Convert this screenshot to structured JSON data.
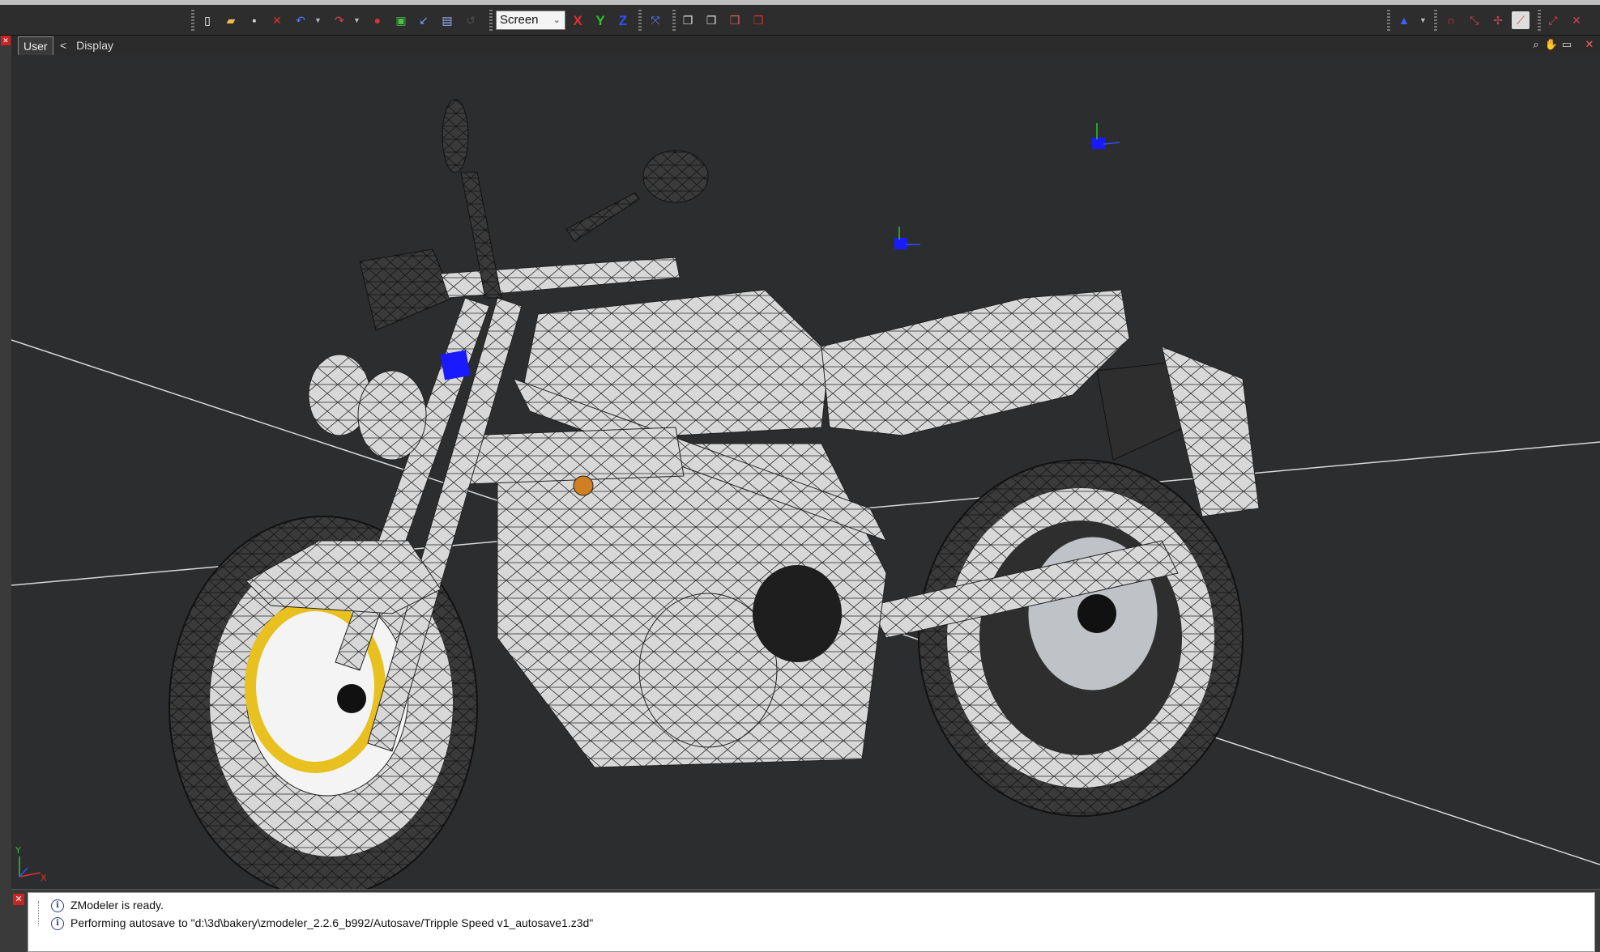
{
  "toolbar": {
    "coord_system": "Screen",
    "axis_x": "X",
    "axis_y": "Y",
    "axis_z": "Z"
  },
  "viewport": {
    "view_label": "User",
    "display_tab": "Display",
    "back_glyph": "<",
    "gizmo_y": "Y",
    "gizmo_x": "X"
  },
  "log": {
    "lines": [
      "ZModeler is ready.",
      "Performing autosave to \"d:\\3d\\bakery\\zmodeler_2.2.6_b992/Autosave/Tripple Speed v1_autosave1.z3d\""
    ]
  },
  "colors": {
    "accent_blue": "#1a1aff",
    "close_red": "#cc2222",
    "axis_x": "#e03030",
    "axis_y": "#30c030",
    "axis_z": "#3050ff",
    "viewport_bg": "#2c2d2e"
  },
  "icons": [
    "new-file-icon",
    "open-file-icon",
    "save-icon",
    "delete-icon",
    "undo-icon",
    "redo-icon",
    "record-icon",
    "render-icon",
    "link-icon",
    "properties-icon",
    "disabled-icon",
    "snap-icon",
    "cube-front-icon",
    "cube-side-icon",
    "cube-top-icon",
    "cube-perspective-icon",
    "cone-icon",
    "magnet-icon",
    "transform-icon",
    "chart-icon",
    "lock-icon",
    "zoom-icon",
    "pan-icon",
    "maximize-icon",
    "close-icon",
    "info-icon"
  ]
}
